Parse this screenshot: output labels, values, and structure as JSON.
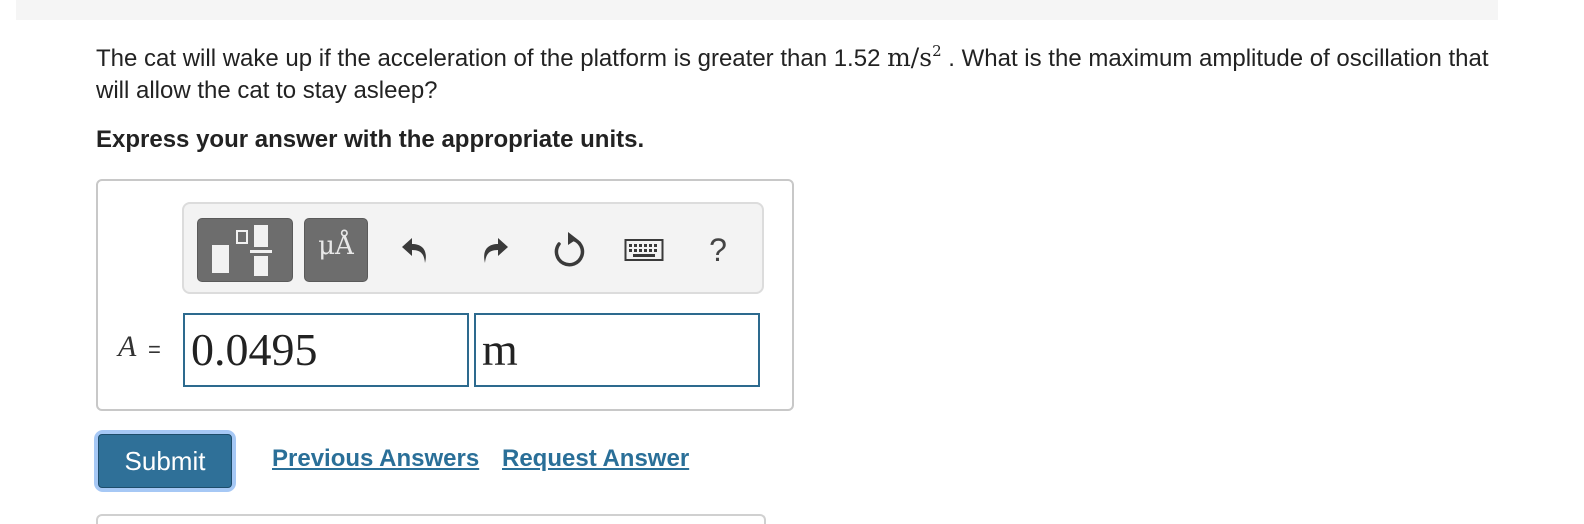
{
  "question": {
    "text_before": "The cat will wake up if the acceleration of the platform is greater than 1.52 ",
    "unit_base": "m/s",
    "unit_exp": "2",
    "text_after": " . What is the maximum amplitude of oscillation that will allow the cat to stay asleep?"
  },
  "instruction": "Express your answer with the appropriate units.",
  "toolbar": {
    "templates_icon": "templates-icon",
    "units_label": "μÅ",
    "undo_icon": "undo-icon",
    "redo_icon": "redo-icon",
    "reset_icon": "reset-icon",
    "keyboard_icon": "keyboard-icon",
    "help_label": "?"
  },
  "answer": {
    "variable": "A",
    "equals": "=",
    "value": "0.0495",
    "unit": "m"
  },
  "actions": {
    "submit_label": "Submit",
    "previous_answers_label": "Previous Answers",
    "request_answer_label": "Request Answer"
  },
  "colors": {
    "accent": "#2f7098",
    "link": "#2a6f98",
    "field_border": "#2d6a8e",
    "focus_ring": "#a6c8f5"
  }
}
